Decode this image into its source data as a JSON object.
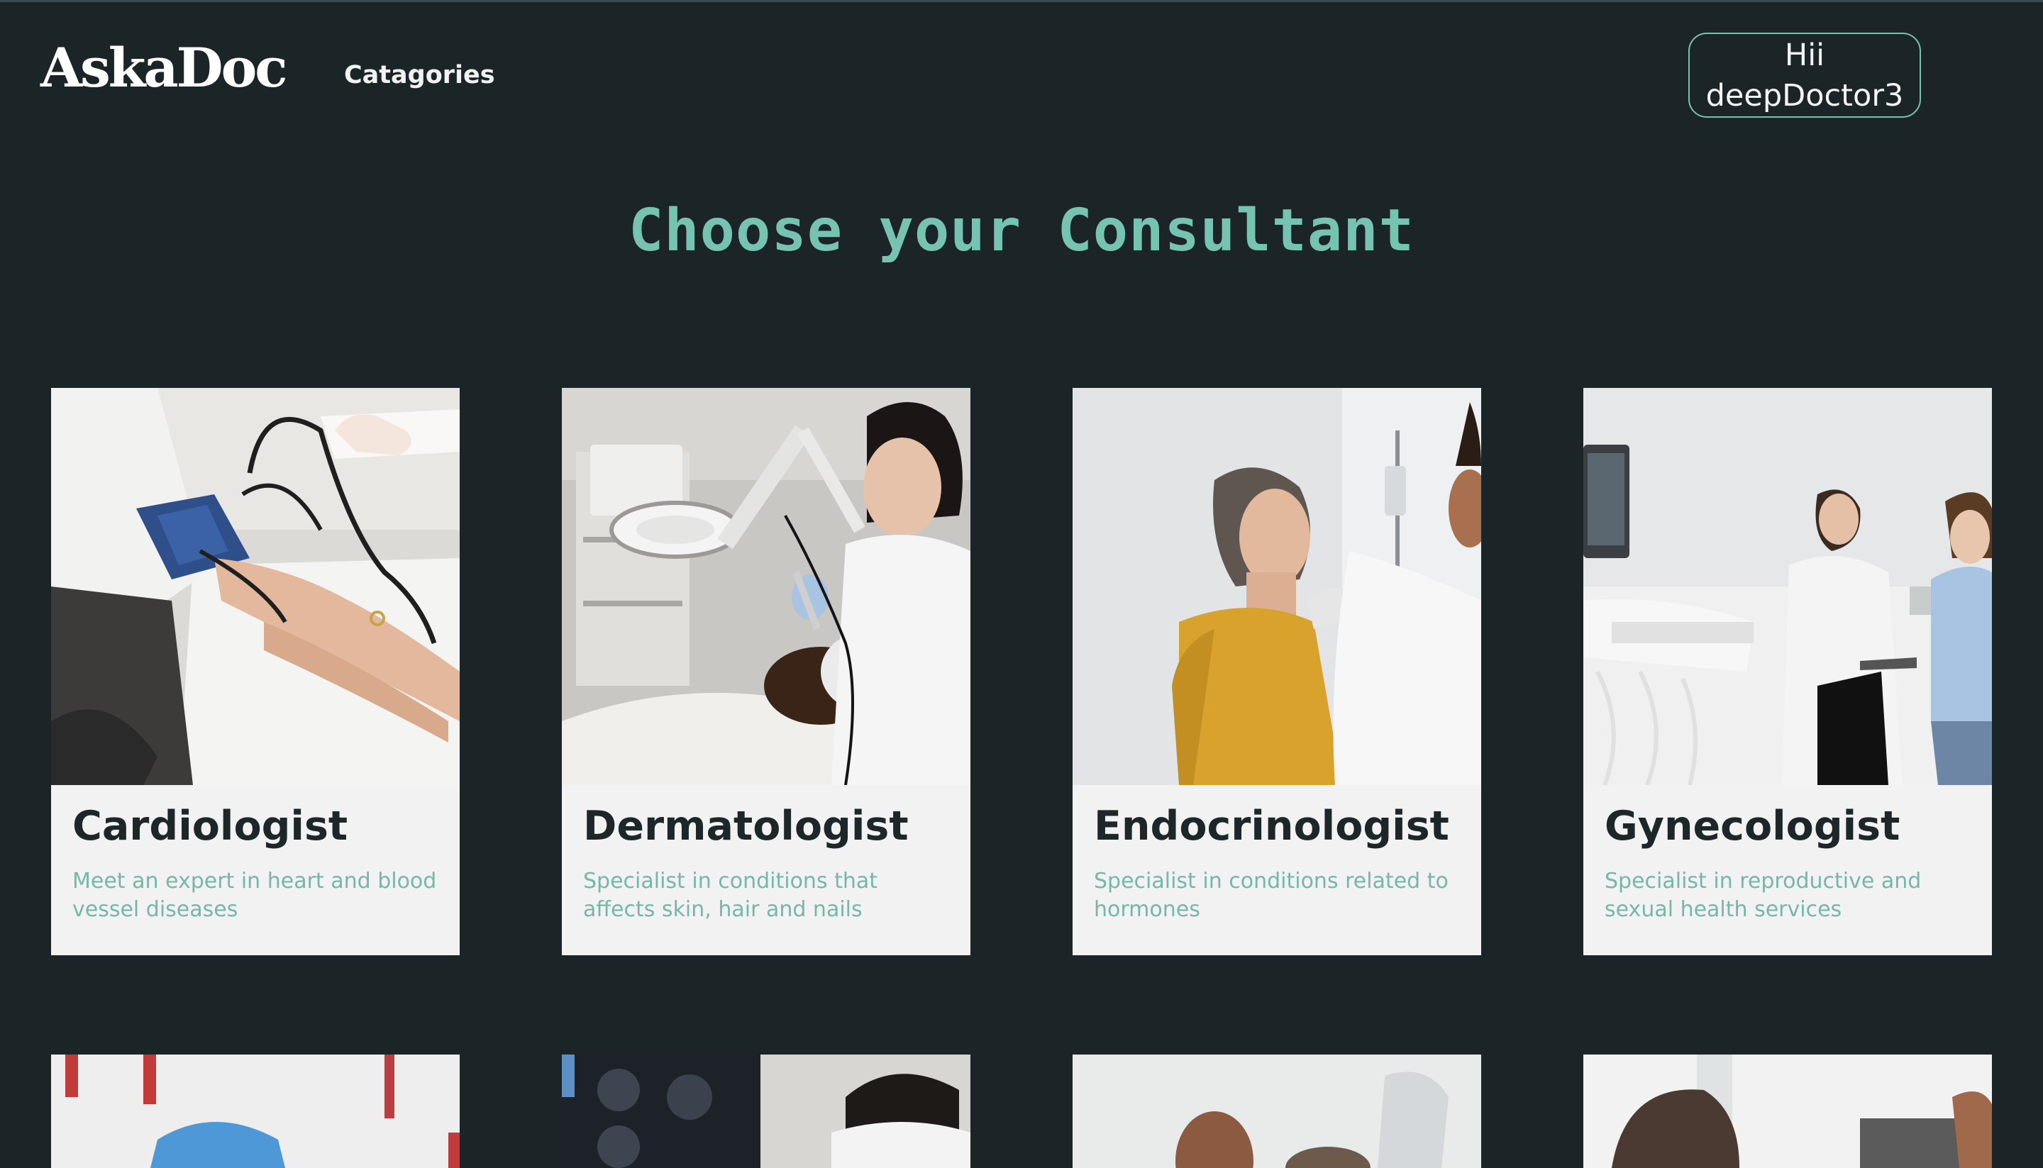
{
  "header": {
    "logo": "AskaDoc",
    "nav_categories": "Catagories",
    "user_line1": "Hii",
    "user_line2": "deepDoctor3"
  },
  "page_title": "Choose your Consultant",
  "colors": {
    "background": "#1b2528",
    "accent": "#75c3b0",
    "card_background": "#f2f2f2",
    "card_title": "#1d2629",
    "card_description": "#75b8a6"
  },
  "consultants": [
    {
      "title": "Cardiologist",
      "description": "Meet an expert in heart and blood vessel diseases",
      "image": "blood-pressure-check-photo"
    },
    {
      "title": "Dermatologist",
      "description": "Specialist in conditions that affects skin, hair and nails",
      "image": "facial-skin-treatment-photo"
    },
    {
      "title": "Endocrinologist",
      "description": "Specialist in conditions related to hormones",
      "image": "neck-examination-photo"
    },
    {
      "title": "Gynecologist",
      "description": "Specialist in reproductive and sexual health services",
      "image": "ultrasound-consultation-photo"
    }
  ],
  "more_cards": [
    {
      "image": "gloved-hands-photo"
    },
    {
      "image": "brain-scan-photo"
    },
    {
      "image": "doctor-patient-photo"
    },
    {
      "image": "x-ray-review-photo"
    }
  ]
}
